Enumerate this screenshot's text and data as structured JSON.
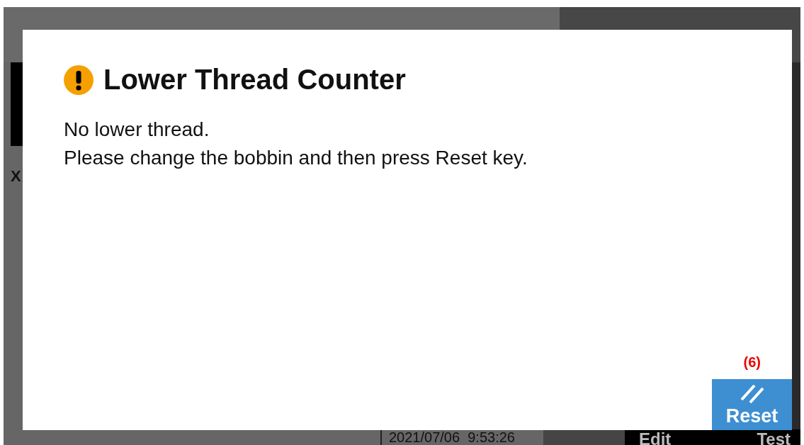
{
  "background": {
    "axis_label": "X",
    "datetime": "2021/07/06  9:53:26",
    "buttons": [
      {
        "label": "Edit"
      },
      {
        "label": "Test"
      }
    ]
  },
  "dialog": {
    "title": "Lower Thread Counter",
    "message": [
      "No lower thread.",
      "Please change the bobbin and then press Reset key."
    ],
    "annotation": "(6)",
    "button": {
      "label": "Reset"
    }
  }
}
